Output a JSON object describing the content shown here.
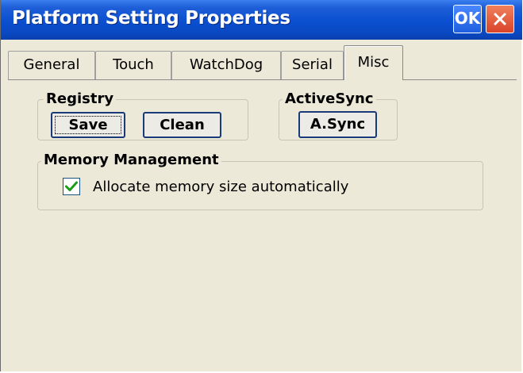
{
  "window": {
    "title": "Platform Setting Properties",
    "ok_label": "OK",
    "close_icon": "close-icon",
    "colors": {
      "titlebar": "#0a4fd0",
      "ok": "#1e5fe0",
      "close": "#d9442a",
      "check": "#1b9c1b"
    }
  },
  "tabs": [
    {
      "label": "General",
      "active": false
    },
    {
      "label": "Touch",
      "active": false
    },
    {
      "label": "WatchDog",
      "active": false
    },
    {
      "label": "Serial",
      "active": false
    },
    {
      "label": "Misc",
      "active": true
    }
  ],
  "registry": {
    "label": "Registry",
    "save_label": "Save",
    "clean_label": "Clean"
  },
  "activesync": {
    "label": "ActiveSync",
    "button_label": "A.Sync"
  },
  "memory": {
    "label": "Memory Management",
    "auto_checkbox": {
      "label": "Allocate memory size automatically",
      "checked": true
    }
  }
}
